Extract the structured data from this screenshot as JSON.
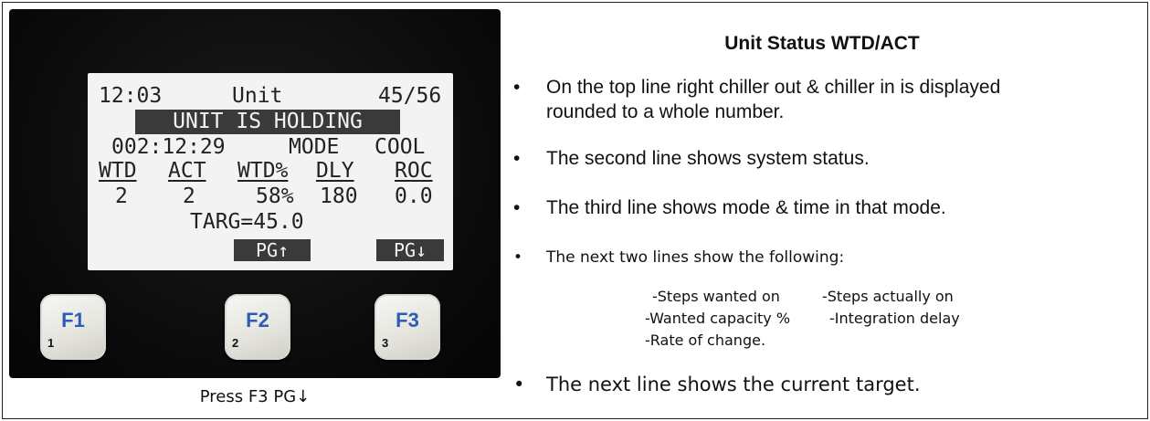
{
  "lcd": {
    "time": "12:03",
    "label": "Unit",
    "temps": "45/56",
    "status": "UNIT IS HOLDING",
    "runtime": "002:12:29",
    "mode_label": "MODE",
    "mode_value": "COOL",
    "headers": [
      "WTD",
      "ACT",
      "WTD%",
      "DLY",
      "ROC"
    ],
    "values": [
      "2",
      "2",
      "58%",
      "180",
      "0.0"
    ],
    "target": "TARG=45.0",
    "pg_up": "PG↑",
    "pg_down": "PG↓"
  },
  "keys": [
    {
      "label": "F1",
      "num": "1"
    },
    {
      "label": "F2",
      "num": "2"
    },
    {
      "label": "F3",
      "num": "3"
    }
  ],
  "caption": "Press F3 PG↓",
  "info": {
    "title": "Unit Status WTD/ACT",
    "bullets": [
      "On the top line right chiller out & chiller in is displayed",
      "rounded to a whole number.",
      "The second line shows system status.",
      "The third line shows mode & time in that mode.",
      "The next two lines show the following:",
      "The next line shows the current target."
    ],
    "sub_items": [
      "-Steps wanted on",
      "-Steps actually on",
      "-Wanted capacity %",
      "-Integration delay",
      "-Rate of change."
    ]
  }
}
